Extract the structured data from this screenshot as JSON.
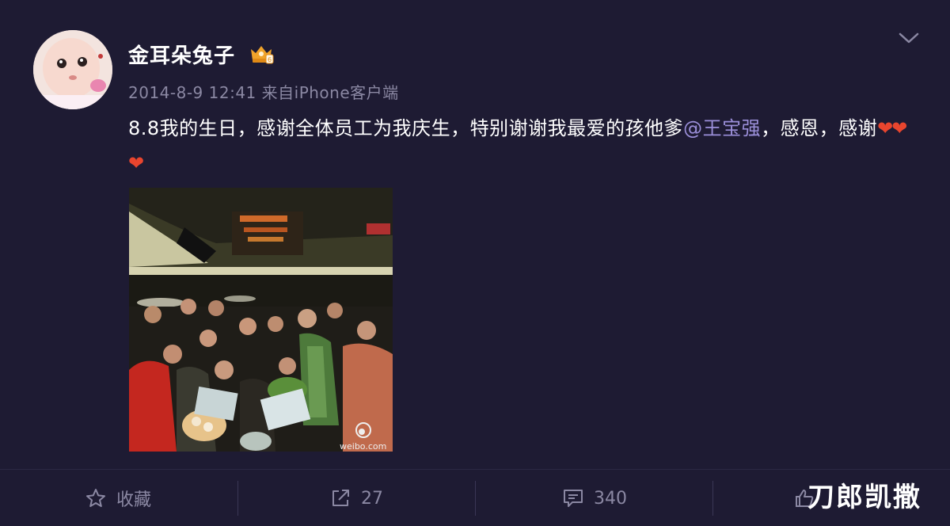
{
  "post": {
    "author": "金耳朵兔子",
    "timestamp": "2014-8-9 12:41",
    "source_prefix": "来自",
    "source": "iPhone客户端",
    "text_before_mention": "8.8我的生日，感谢全体员工为我庆生，特别谢谢我最爱的孩他爹",
    "mention": "@王宝强",
    "text_after_mention": "，感恩，感谢",
    "hearts": "❤❤❤",
    "image_watermark": "weibo.com"
  },
  "icons": {
    "vip": "crown-badge-icon",
    "menu": "chevron-down-icon",
    "favorite": "star-icon",
    "repost": "share-icon",
    "comment": "comment-icon",
    "like": "thumbs-up-icon"
  },
  "actions": {
    "favorite_label": "收藏",
    "repost_count": "27",
    "comment_count": "340"
  },
  "overlay_watermark": "刀郎凯撒",
  "colors": {
    "background": "#1e1b33",
    "mention": "#9b8fd9",
    "muted": "#8b88a3",
    "heart": "#e8452e"
  }
}
